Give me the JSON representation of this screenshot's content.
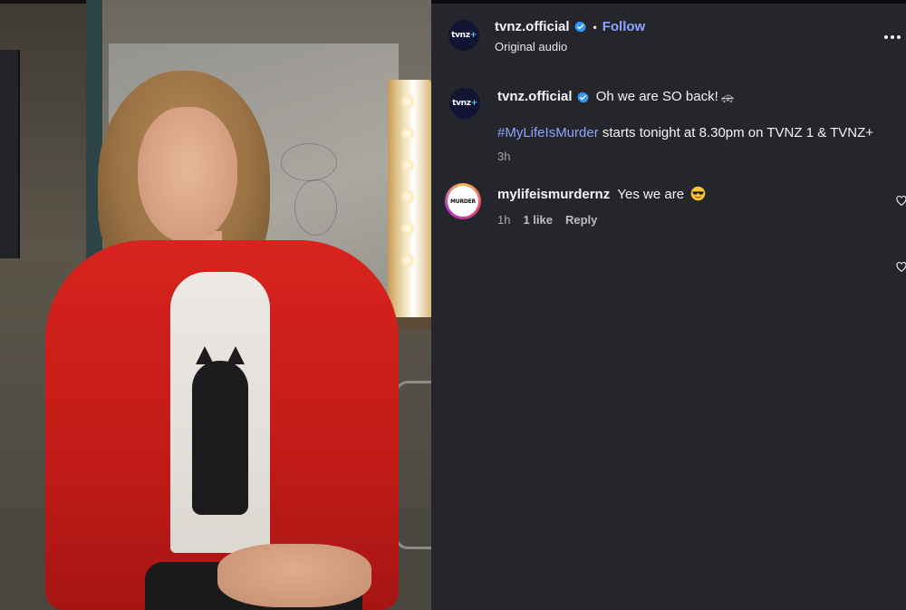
{
  "post": {
    "author": "tvnz.official",
    "follow_label": "Follow",
    "dot": "•",
    "audio_label": "Original audio",
    "avatar_logo": "tvnz",
    "avatar_plus": "+"
  },
  "caption": {
    "author": "tvnz.official",
    "text_main": "Oh we are SO back!",
    "car_emoji": "🚓",
    "hashtag": "#MyLifeIsMurder",
    "text_rest": " starts tonight at 8.30pm on TVNZ 1 & TVNZ+",
    "time": "3h"
  },
  "comments": [
    {
      "author": "mylifeismurdernz",
      "avatar_text": "MURDER",
      "text": "Yes we are",
      "emoji": "smiling-face-with-sunglasses",
      "time": "1h",
      "likes": "1 like",
      "reply_label": "Reply"
    }
  ],
  "colors": {
    "panel_bg": "#25262b",
    "link_blue": "#8aa4ff",
    "verified_blue": "#3897f0",
    "jacket_red": "#d8231e"
  },
  "icons": [
    "verified-badge-icon",
    "more-options-icon",
    "heart-icon",
    "police-car-emoji",
    "sunglasses-emoji"
  ]
}
